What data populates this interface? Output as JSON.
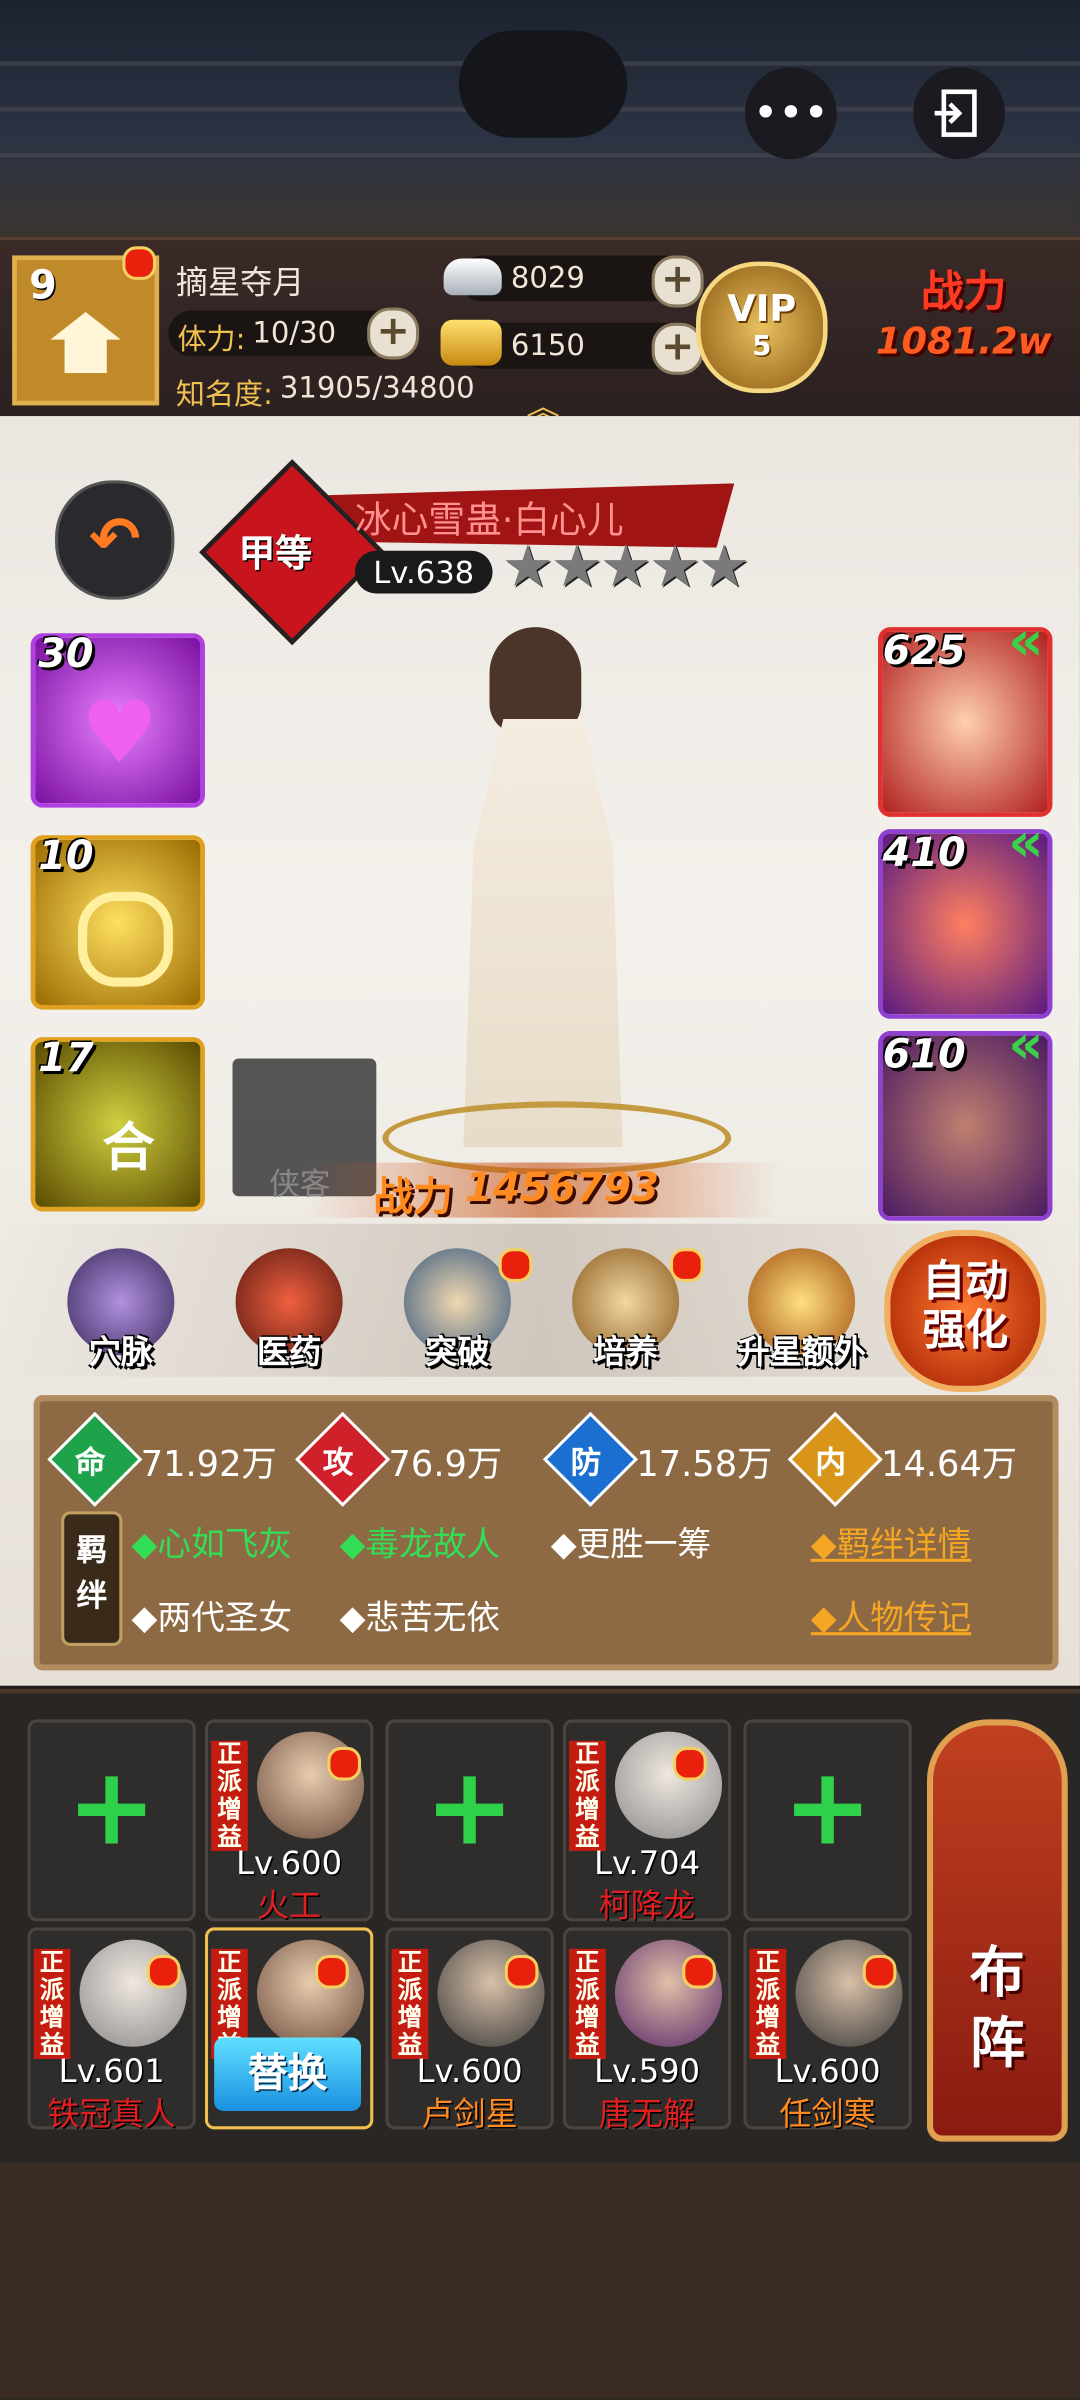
{
  "header": {
    "more_icon": "more-dots",
    "exit_icon": "exit-door"
  },
  "player": {
    "level": "9",
    "name": "摘星夺月",
    "stamina_label": "体力:",
    "stamina_value": "10/30",
    "fame_label": "知名度:",
    "fame_value": "31905/34800",
    "silver": "8029",
    "gold": "6150",
    "vip_text": "VIP",
    "vip_level": "5",
    "power_label": "战力",
    "power_value": "1081.2w"
  },
  "hero": {
    "grade": "甲等",
    "name": "冰心雪蛊·白心儿",
    "level": "Lv.638",
    "stars": 5,
    "power_label": "战力",
    "power_value": "1456793",
    "placeholder_label": "侠客"
  },
  "skills": [
    {
      "count": "30"
    },
    {
      "count": "10"
    },
    {
      "count": "17"
    }
  ],
  "equipment": [
    {
      "count": "625"
    },
    {
      "count": "410"
    },
    {
      "count": "610"
    }
  ],
  "menu": [
    "穴脉",
    "医药",
    "突破",
    "培养",
    "升星额外"
  ],
  "auto_button": "自动强化",
  "stats": [
    {
      "icon": "命",
      "value": "71.92万",
      "color": "#1ea24a"
    },
    {
      "icon": "攻",
      "value": "76.9万",
      "color": "#d0202a"
    },
    {
      "icon": "防",
      "value": "17.58万",
      "color": "#1a6fd0"
    },
    {
      "icon": "内",
      "value": "14.64万",
      "color": "#d9941a"
    }
  ],
  "bonds": {
    "label": "羁绊",
    "items": [
      {
        "text": "◆心如飞灰",
        "active": true
      },
      {
        "text": "◆毒龙故人",
        "active": true
      },
      {
        "text": "◆更胜一筹",
        "active": false
      },
      {
        "text": "◆两代圣女",
        "active": false
      },
      {
        "text": "◆悲苦无依",
        "active": false
      }
    ],
    "detail_link": "◆羁绊详情",
    "bio_link": "◆人物传记"
  },
  "team": {
    "tag": "正派增益",
    "row1": [
      {
        "empty": true
      },
      {
        "level": "Lv.600",
        "name": "火工"
      },
      {
        "empty": true
      },
      {
        "level": "Lv.704",
        "name": "柯降龙"
      },
      {
        "empty": true
      }
    ],
    "row2": [
      {
        "level": "Lv.601",
        "name": "铁冠真人"
      },
      {
        "replace": "替换"
      },
      {
        "level": "Lv.600",
        "name": "卢剑星"
      },
      {
        "level": "Lv.590",
        "name": "唐无解"
      },
      {
        "level": "Lv.600",
        "name": "任剑寒"
      }
    ],
    "formation_button": "布阵"
  },
  "colors": {
    "accent_gold": "#f0c050",
    "plus_green": "#2fd04a",
    "name_red": "#e02020",
    "name_orange": "#ff8a20"
  }
}
